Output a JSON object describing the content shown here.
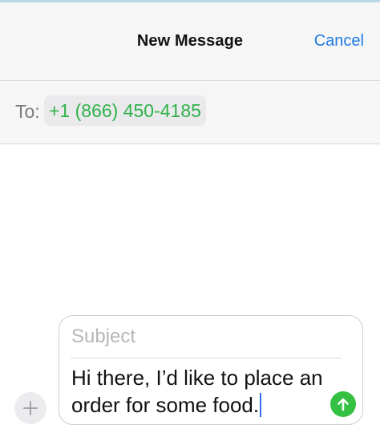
{
  "header": {
    "title": "New Message",
    "cancel_label": "Cancel"
  },
  "recipients": {
    "to_label": "To:",
    "items": [
      {
        "number": "+1 (866) 450-4185"
      }
    ]
  },
  "composer": {
    "subject_placeholder": "Subject",
    "message_text": "Hi there, I’d like to place an order for some food."
  },
  "icons": {
    "add": "plus-icon",
    "send": "arrow-up-icon"
  },
  "colors": {
    "accent_blue": "#1f7ae0",
    "recipient_green": "#30b24a",
    "send_green": "#34c043",
    "caret_blue": "#2f6fe0"
  }
}
